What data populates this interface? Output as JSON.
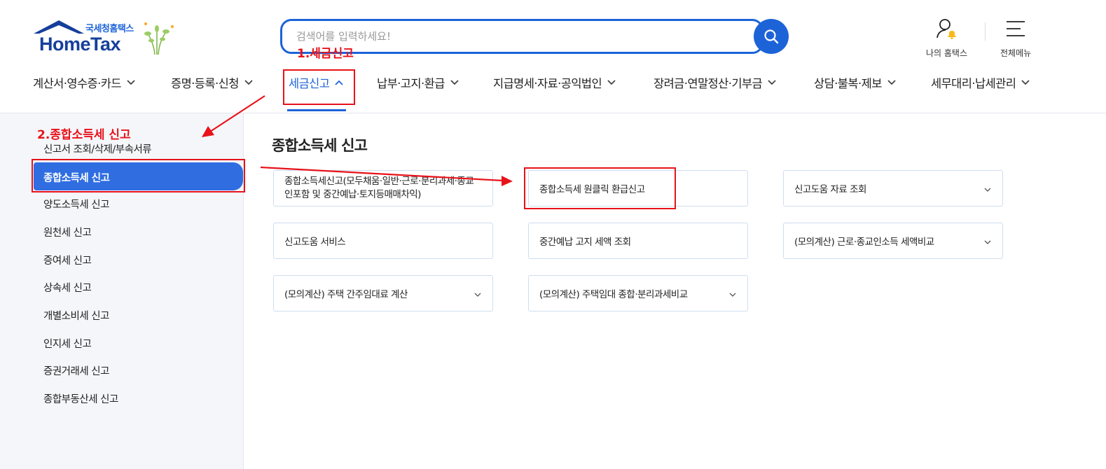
{
  "logo": {
    "subtitle": "국세청홈택스",
    "title": "HomeTax"
  },
  "search": {
    "placeholder": "검색어를 입력하세요!"
  },
  "utility": {
    "my_hometax": "나의 홈택스",
    "all_menu": "전체메뉴"
  },
  "gnb": [
    {
      "label": "계산서·영수증·카드"
    },
    {
      "label": "증명·등록·신청"
    },
    {
      "label": "세금신고"
    },
    {
      "label": "납부·고지·환급"
    },
    {
      "label": "지급명세·자료·공익법인"
    },
    {
      "label": "장려금·연말정산·기부금"
    },
    {
      "label": "상담·불복·제보"
    },
    {
      "label": "세무대리·납세관리"
    }
  ],
  "lnb": [
    {
      "label": "신고서 조회/삭제/부속서류"
    },
    {
      "label": "종합소득세 신고"
    },
    {
      "label": "양도소득세 신고"
    },
    {
      "label": "원천세 신고"
    },
    {
      "label": "증여세 신고"
    },
    {
      "label": "상속세 신고"
    },
    {
      "label": "개별소비세 신고"
    },
    {
      "label": "인지세 신고"
    },
    {
      "label": "증권거래세 신고"
    },
    {
      "label": "종합부동산세 신고"
    }
  ],
  "content": {
    "title": "종합소득세 신고",
    "cards": [
      {
        "label": "종합소득세신고(모두채움·일반·근로·분리과세·종교인포함 및 중간예납·토지등매매차익)"
      },
      {
        "label": "종합소득세 원클릭 환급신고"
      },
      {
        "label": "신고도움 자료 조회"
      },
      {
        "label": "신고도움 서비스"
      },
      {
        "label": "중간예납 고지 세액 조회"
      },
      {
        "label": "(모의계산) 근로·종교인소득 세액비교"
      },
      {
        "label": "(모의계산) 주택 간주임대료 계산"
      },
      {
        "label": "(모의계산) 주택임대 종합·분리과세비교"
      }
    ]
  },
  "annotations": {
    "step1": "1.세금신고",
    "step2": "2.종합소득세 신고",
    "color": "#e8121a"
  },
  "colors": {
    "brand": "#1d63d8",
    "active_menu": "#2f6de1",
    "card_border": "#cfddf0"
  }
}
